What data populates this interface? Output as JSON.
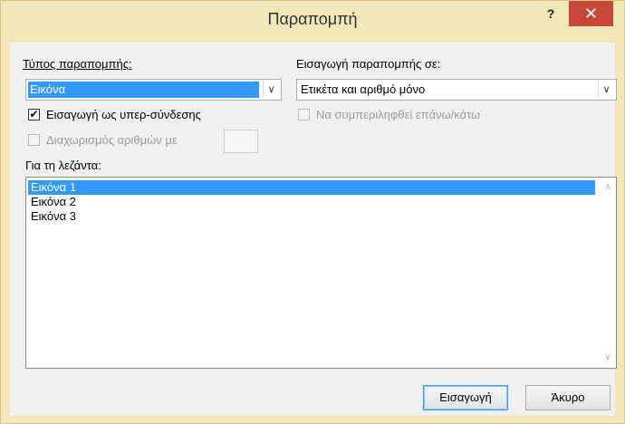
{
  "window": {
    "title": "Παραπομπή",
    "help_label": "?",
    "close_label": "✕"
  },
  "reference_type": {
    "label": "Τύπος παραπομπής:",
    "value": "Εικόνα"
  },
  "insert_reference_to": {
    "label": "Εισαγωγή παραπομπής σε:",
    "value": "Ετικέτα και αριθμό μόνο"
  },
  "options": {
    "insert_as_hyperlink": {
      "label": "Εισαγωγή ως υπερ-σύνδεσης",
      "checked": true
    },
    "include_above_below": {
      "label": "Να συμπεριληφθεί επάνω/κάτω",
      "checked": false,
      "enabled": false
    },
    "separate_numbers": {
      "label": "Διαχωρισμός αριθμών με",
      "checked": false,
      "enabled": false,
      "value": ""
    }
  },
  "caption_list": {
    "label": "Για τη λεζάντα:",
    "items": [
      "Εικόνα 1",
      "Εικόνα 2",
      "Εικόνα 3"
    ],
    "selected_index": 0
  },
  "buttons": {
    "insert": "Εισαγωγή",
    "cancel": "Άκυρο"
  },
  "icons": {
    "dropdown": "chevron-down-icon",
    "check": "checkmark-icon",
    "scroll_up": "scroll-up-arrow-icon",
    "scroll_down": "scroll-down-arrow-icon",
    "close": "close-icon"
  },
  "colors": {
    "title_bar": "#f2e7b8",
    "close_button": "#c7473b",
    "selection": "#3399ff"
  }
}
